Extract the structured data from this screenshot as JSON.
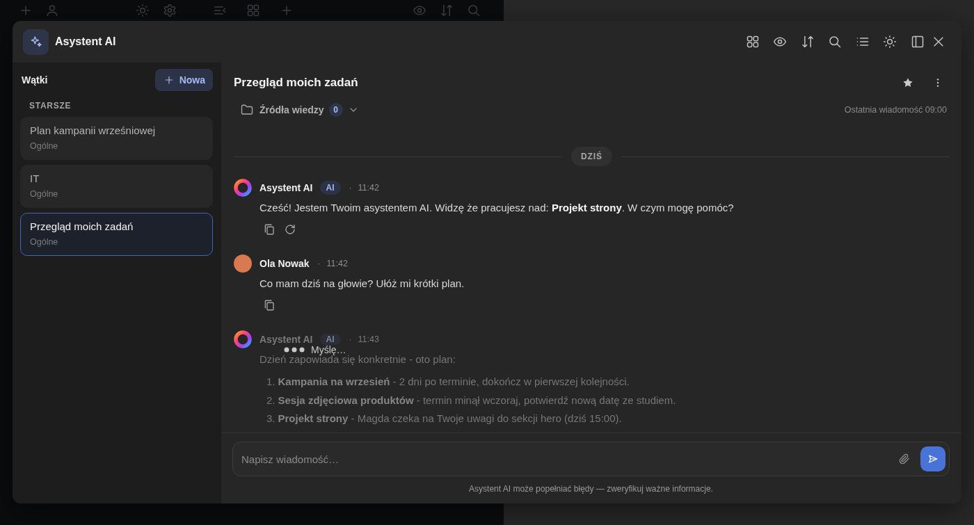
{
  "window": {
    "title": "Asystent AI"
  },
  "sidebar": {
    "title": "Wątki",
    "new_button": "Nowa",
    "section": "STARSZE",
    "threads": [
      {
        "title": "Plan kampanii wrześniowej",
        "category": "Ogólne",
        "selected": false
      },
      {
        "title": "IT",
        "category": "Ogólne",
        "selected": false
      },
      {
        "title": "Przegląd moich zadań",
        "category": "Ogólne",
        "selected": true
      }
    ]
  },
  "chat": {
    "title": "Przegląd moich zadań",
    "sources": {
      "label": "Źródła wiedzy",
      "count": "0"
    },
    "last_message": "Ostatnia wiadomość 09:00",
    "date_divider": "DZIŚ",
    "messages": [
      {
        "kind": "assistant",
        "author": "Asystent AI",
        "badge": "AI",
        "separator": "·",
        "time": "11:42",
        "text": "Cześć! Jestem Twoim asystentem AI. Widzę że pracujesz nad: **Projekt strony**. W czym mogę pomóc?"
      },
      {
        "kind": "user",
        "author": "Ola Nowak",
        "separator": "·",
        "time": "11:42",
        "text": "Co mam dziś na głowie? Ułóż mi krótki plan."
      },
      {
        "kind": "thinking",
        "author": "Asystent AI",
        "badge": "AI",
        "separator": "·",
        "time": "11:43",
        "status": "Myślę…",
        "text": "Dzień zapowiada się konkretnie - oto plan:",
        "list": [
          {
            "number": "1.",
            "text": "**Kampania na wrzesień** - 2 dni po terminie, dokończ w pierwszej kolejności."
          },
          {
            "number": "2.",
            "text": "**Sesja zdjęciowa produktów** - termin minął wczoraj, potwierdź nową datę ze studiem."
          },
          {
            "number": "3.",
            "text": "**Projekt strony** - Magda czeka na Twoje uwagi do sekcji hero (dziś 15:00)."
          }
        ]
      }
    ]
  },
  "composer": {
    "placeholder": "Napisz wiadomość…",
    "disclaimer": "Asystent AI może popełniać błędy — zweryfikuj ważne informacje."
  }
}
